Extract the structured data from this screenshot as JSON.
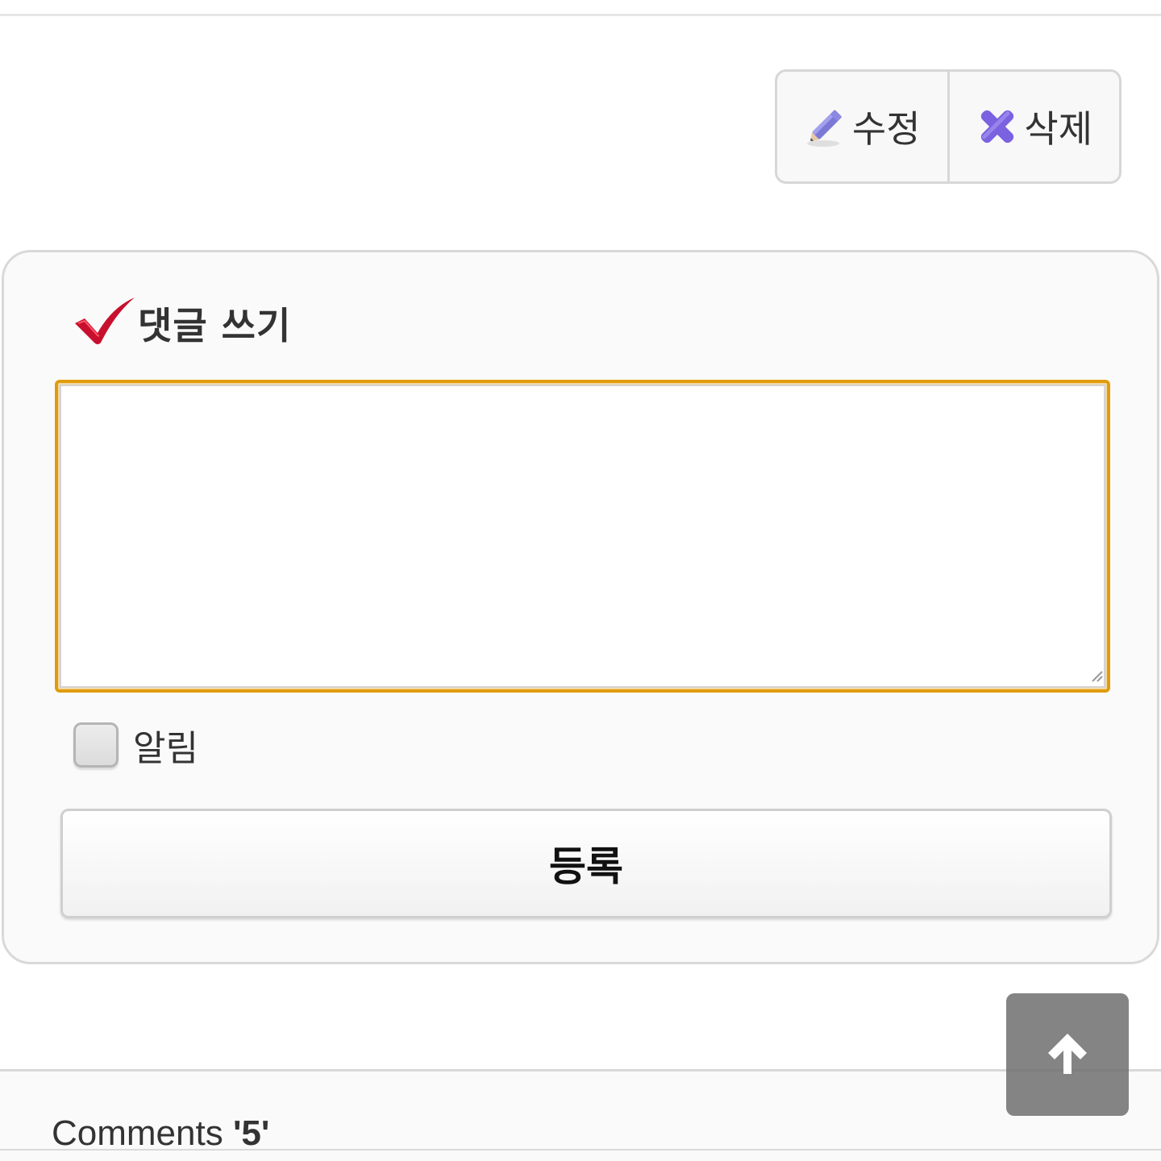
{
  "toolbar": {
    "edit_label": "수정",
    "edit_icon": "pencil-icon",
    "delete_label": "삭제",
    "delete_icon": "x-cross-icon"
  },
  "comment_write": {
    "title": "댓글 쓰기",
    "title_icon": "red-checkmark-icon",
    "textarea_value": "",
    "textarea_focus_color": "#e09c0e",
    "notify_label": "알림",
    "notify_checked": false,
    "submit_label": "등록"
  },
  "comments": {
    "label": "Comments",
    "count_display": "'5'"
  },
  "scroll_top": {
    "icon": "arrow-up-icon"
  }
}
